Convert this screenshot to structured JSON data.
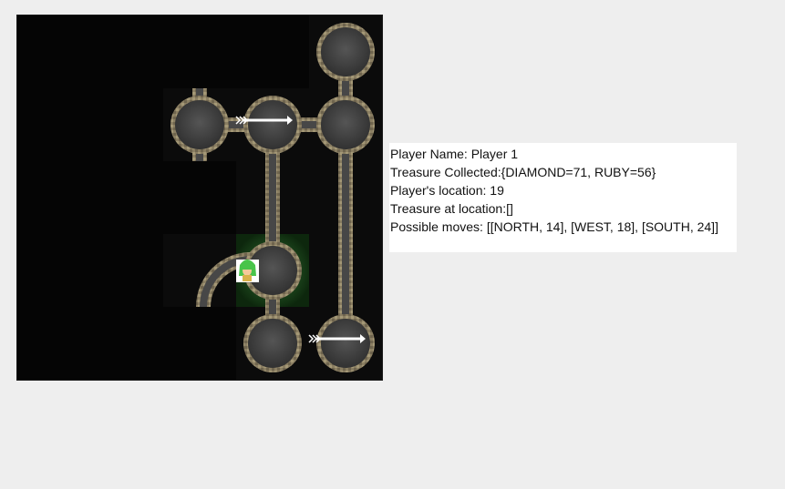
{
  "info": {
    "player_name": "Player Name: Player 1",
    "treasure_collected": "Treasure Collected:{DIAMOND=71, RUBY=56}",
    "player_location": "Player's location: 19",
    "treasure_at_location": "Treasure at location:[]",
    "possible_moves": "Possible moves: [[NORTH, 14], [WEST, 18], [SOUTH, 24]]"
  },
  "colors": {
    "wall": "#8f8468",
    "floor": "#4a4a4a",
    "room": "#3a3a3a",
    "highlight": "#2f7a2f",
    "background": "#050505"
  },
  "icons": {
    "player": "player-avatar-icon",
    "arrow": "arrow-icon"
  }
}
